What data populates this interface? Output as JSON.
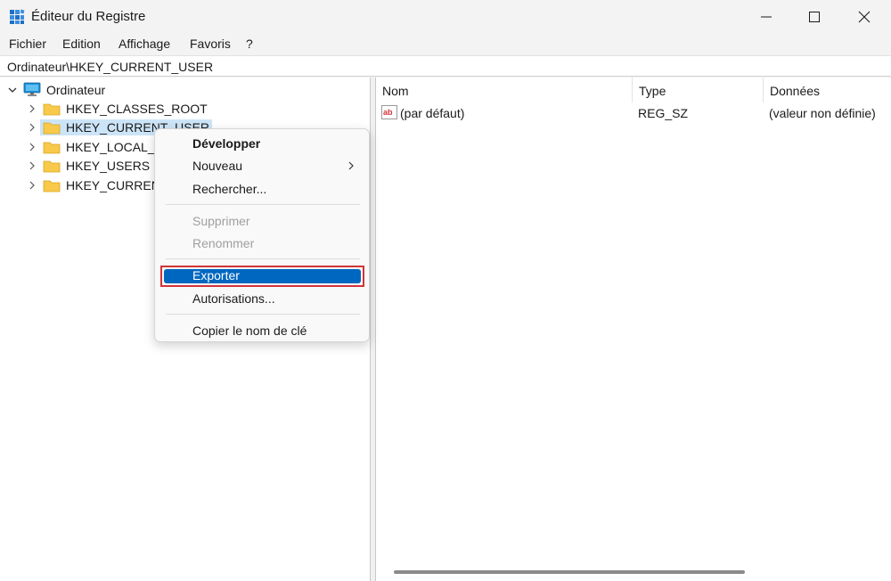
{
  "window": {
    "title": "Éditeur du Registre"
  },
  "menubar": {
    "items": [
      "Fichier",
      "Edition",
      "Affichage",
      "Favoris",
      "?"
    ]
  },
  "address": {
    "path": "Ordinateur\\HKEY_CURRENT_USER"
  },
  "tree": {
    "root": "Ordinateur",
    "items": [
      "HKEY_CLASSES_ROOT",
      "HKEY_CURRENT_USER",
      "HKEY_LOCAL_M",
      "HKEY_USERS",
      "HKEY_CURRENT"
    ],
    "selected_index": 1
  },
  "list": {
    "columns": [
      "Nom",
      "Type",
      "Données"
    ],
    "rows": [
      {
        "name": "(par défaut)",
        "type": "REG_SZ",
        "data": "(valeur non définie)"
      }
    ]
  },
  "context_menu": {
    "items": [
      {
        "label": "Développer",
        "state": "bold"
      },
      {
        "label": "Nouveau",
        "state": "submenu"
      },
      {
        "label": "Rechercher...",
        "state": "normal"
      },
      {
        "label": "Supprimer",
        "state": "disabled"
      },
      {
        "label": "Renommer",
        "state": "disabled"
      },
      {
        "label": "Exporter",
        "state": "highlighted"
      },
      {
        "label": "Autorisations...",
        "state": "normal"
      },
      {
        "label": "Copier le nom de clé",
        "state": "normal"
      }
    ]
  },
  "colors": {
    "highlight": "#0067c0",
    "callout_border": "#d13438",
    "tree_selection": "#cce4f7",
    "folder": "#f8c94a"
  },
  "icons": {
    "app": "registry-editor-icon",
    "computer": "computer-icon",
    "folder": "folder-icon",
    "string_value": "ab-string-value-icon"
  }
}
